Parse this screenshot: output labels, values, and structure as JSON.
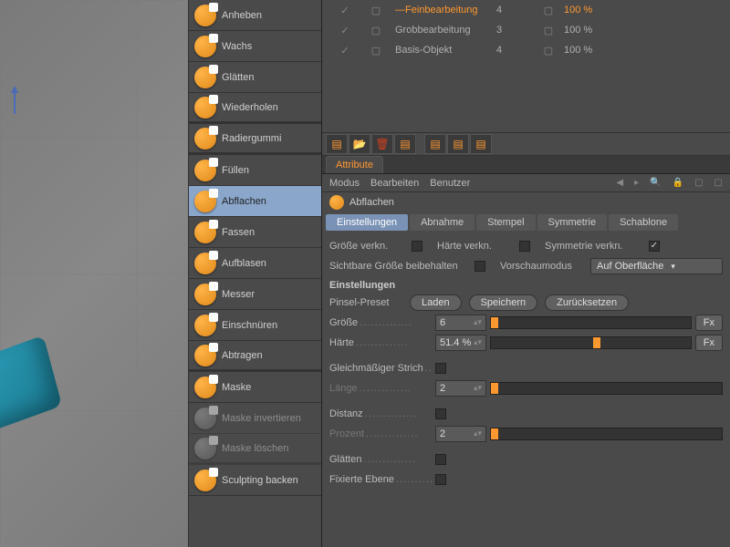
{
  "tools": [
    {
      "label": "Anheben"
    },
    {
      "label": "Wachs"
    },
    {
      "label": "Glätten"
    },
    {
      "label": "Wiederholen",
      "sep": true
    },
    {
      "label": "Radiergummi",
      "sep": true
    },
    {
      "label": "Füllen"
    },
    {
      "label": "Abflachen",
      "selected": true
    },
    {
      "label": "Fassen"
    },
    {
      "label": "Aufblasen"
    },
    {
      "label": "Messer"
    },
    {
      "label": "Einschnüren"
    },
    {
      "label": "Abtragen",
      "sep": true
    },
    {
      "label": "Maske"
    },
    {
      "label": "Maske invertieren",
      "disabled": true,
      "gray": true
    },
    {
      "label": "Maske löschen",
      "disabled": true,
      "gray": true,
      "sep": true
    },
    {
      "label": "Sculpting backen"
    }
  ],
  "table": [
    {
      "chk1": "✓",
      "name": "Feinbearbeitung",
      "n": "4",
      "pct": "100 %",
      "active": true
    },
    {
      "chk1": "✓",
      "name": "Grobbearbeitung",
      "n": "3",
      "pct": "100 %"
    },
    {
      "chk1": "✓",
      "name": "Basis-Objekt",
      "n": "4",
      "pct": "100 %"
    }
  ],
  "toolbar_icons": [
    "📄",
    "📂",
    "🗑",
    "⎘",
    " ",
    "⎘",
    "⎘",
    "⎘"
  ],
  "attr_tab": "Attribute",
  "mode_bar": {
    "a": "Modus",
    "b": "Bearbeiten",
    "c": "Benutzer"
  },
  "header_title": "Abflachen",
  "sub_tabs": [
    "Einstellungen",
    "Abnahme",
    "Stempel",
    "Symmetrie",
    "Schablone"
  ],
  "row1": {
    "a": "Größe verkn.",
    "b": "Härte verkn.",
    "c": "Symmetrie verkn."
  },
  "row2": {
    "a": "Sichtbare Größe beibehalten",
    "b": "Vorschaumodus",
    "c": "Auf Oberfläche"
  },
  "sec_head": "Einstellungen",
  "preset": {
    "label": "Pinsel-Preset",
    "b1": "Laden",
    "b2": "Speichern",
    "b3": "Zurücksetzen"
  },
  "size": {
    "label": "Größe",
    "val": "6",
    "fx": "Fx"
  },
  "hard": {
    "label": "Härte",
    "val": "51.4 %",
    "fx": "Fx"
  },
  "stroke": "Gleichmäßiger Strich",
  "length": {
    "label": "Länge",
    "val": "2"
  },
  "dist": "Distanz",
  "percent": {
    "label": "Prozent",
    "val": "2"
  },
  "smooth": "Glätten",
  "fixed": "Fixierte Ebene"
}
